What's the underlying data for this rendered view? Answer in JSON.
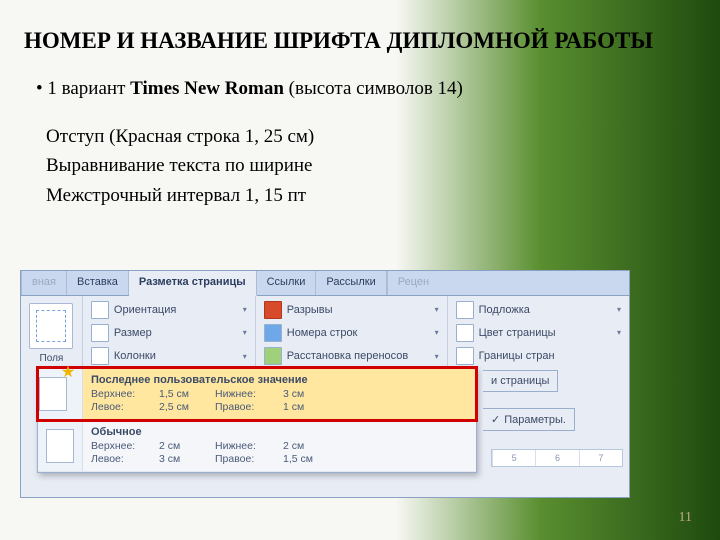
{
  "title": "НОМЕР  И  НАЗВАНИЕ  ШРИФТА ДИПЛОМНОЙ РАБОТЫ",
  "bullet": {
    "pre": "1 вариант ",
    "bold": "Times New Roman",
    "post": " (высота символов 14)"
  },
  "body": {
    "l1": "    Отступ (Красная строка 1, 25 см)",
    "l2": "Выравнивание текста по ширине",
    "l3": "Межстрочный интервал 1, 15 пт"
  },
  "tabs": {
    "t0": "вная",
    "t1": "Вставка",
    "t2": "Разметка страницы",
    "t3": "Ссылки",
    "t4": "Рассылки",
    "t5": "Рецен"
  },
  "fields": "Поля",
  "c2": {
    "a": "Ориентация",
    "b": "Размер",
    "c": "Колонки"
  },
  "c3": {
    "a": "Разрывы",
    "b": "Номера строк",
    "c": "Расстановка переносов"
  },
  "c4": {
    "a": "Подложка",
    "b": "Цвет страницы",
    "c": "Границы стран"
  },
  "menu": {
    "hdr": "Последнее пользовательское значение",
    "r1": {
      "title": "Последнее пользовательское значение",
      "k1": "Верхнее:",
      "v1": "1,5 см",
      "k2": "Нижнее:",
      "v2": "3 см",
      "k3": "Левое:",
      "v3": "2,5 см",
      "k4": "Правое:",
      "v4": "1 см"
    },
    "r2": {
      "title": "Обычное",
      "k1": "Верхнее:",
      "v1": "2 см",
      "k2": "Нижнее:",
      "v2": "2 см",
      "k3": "Левое:",
      "v3": "3 см",
      "k4": "Правое:",
      "v4": "1,5 см"
    }
  },
  "side": {
    "a": "и страницы",
    "b": "Параметры.",
    "ic": "✓"
  },
  "ruler": {
    "a": "5",
    "b": "6",
    "c": "7"
  },
  "pagenum": "11"
}
